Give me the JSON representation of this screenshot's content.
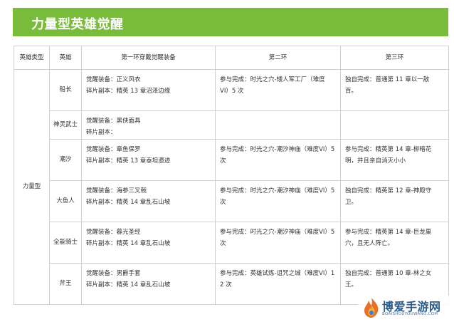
{
  "banner": {
    "title": "力量型英雄觉醒"
  },
  "table": {
    "headers": [
      "英雄类型",
      "英雄",
      "第一环穿戴觉醒装备",
      "第二环",
      "第三环"
    ],
    "type_label": "力量型",
    "rows": [
      {
        "hero": "船长",
        "ring1": [
          "觉醒装备：正义风衣",
          "碎片副本：精英 13 章沼泽边缘"
        ],
        "ring2": [
          "参与完成：时光之穴-矮人军工厂（难度",
          "VI）5 次"
        ],
        "ring3": [
          "独自完成：普通第 11 章以一敌",
          "百。"
        ]
      },
      {
        "hero": "神灵武士",
        "ring1": [
          "觉醒装备：黑侠面具",
          "碎片副本："
        ],
        "ring2": [],
        "ring3": []
      },
      {
        "hero": "潮汐",
        "ring1": [
          "觉醒装备：章鱼保罗",
          "碎片副本：精英 13 章泰坦遗迹"
        ],
        "ring2": [
          "参与完成：时光之穴-潮汐神庙（难度VI）5",
          "次"
        ],
        "ring3": [
          "参与完成：精英第 14 章-柳暗花",
          "明，并且亲自消灭小小"
        ]
      },
      {
        "hero": "大鱼人",
        "ring1": [
          "觉醒装备：海参三叉戟",
          "碎片副本：精英 14 章乱石山坡"
        ],
        "ring2": [
          "参与完成：时光之穴-潮汐神庙（难度VI）5",
          "次"
        ],
        "ring3": [
          "独自完成：精英第 12 章-神殿守",
          "卫。"
        ]
      },
      {
        "hero": "全能骑士",
        "ring1": [
          "觉醒装备：暮光圣经",
          "碎片副本：精英 14 章乱石山坡"
        ],
        "ring2": [
          "参与完成：时光之穴-潮汐神庙（难度VI）5",
          "次"
        ],
        "ring3": [
          "参与完成：精英第 14 章-巨龙巢",
          "穴，且无人阵亡。"
        ]
      },
      {
        "hero": "斧王",
        "ring1": [
          "觉醒装备：男爵手套",
          "碎片副本：精英 14 章乱石山坡"
        ],
        "ring2": [
          "参与完成：英雄试炼-诅咒之城（难度VI）1",
          "2 次"
        ],
        "ring3": [
          "独自完成：普通第 10 章-林之女",
          "王。"
        ]
      }
    ]
  },
  "watermark": {
    "text": "博爱手游网",
    "sub": "BOAISHOUYOUWANG.COM"
  }
}
